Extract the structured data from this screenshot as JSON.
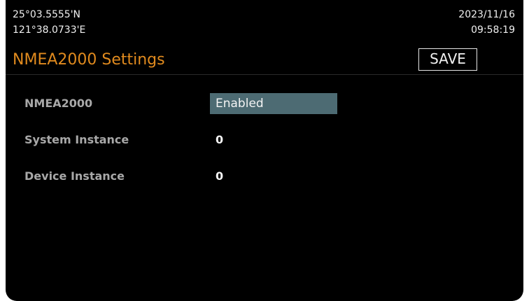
{
  "status": {
    "latitude": "25°03.5555'N",
    "longitude": "121°38.0733'E",
    "date": "2023/11/16",
    "time": "09:58:19"
  },
  "header": {
    "title": "NMEA2000 Settings",
    "save_label": "SAVE"
  },
  "settings": [
    {
      "label": "NMEA2000",
      "value": "Enabled"
    },
    {
      "label": "System Instance",
      "value": "0"
    },
    {
      "label": "Device Instance",
      "value": "0"
    }
  ],
  "colors": {
    "title": "#e08a1e",
    "selection": "#4d6b73",
    "background": "#000000"
  }
}
